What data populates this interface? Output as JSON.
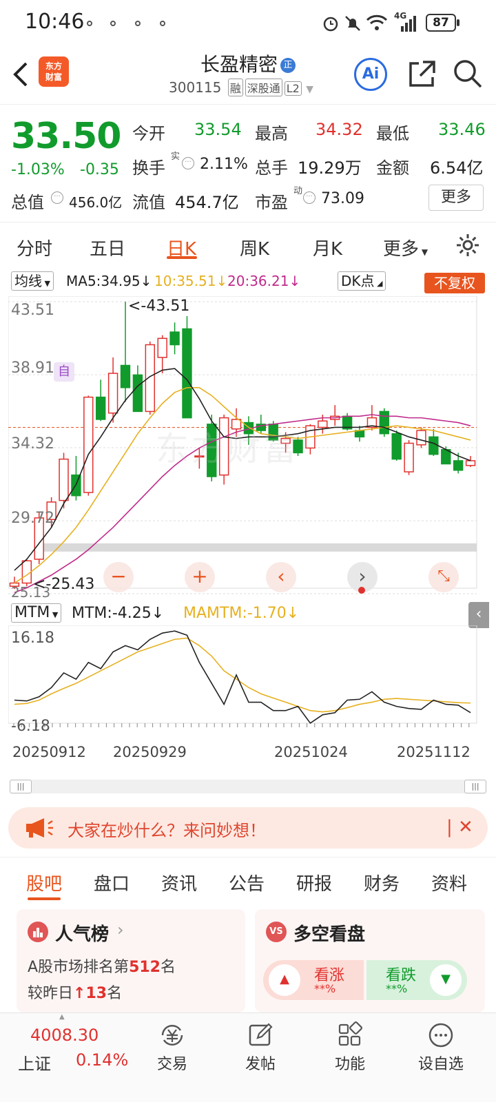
{
  "status_bar": {
    "time": "10:46",
    "battery": "87",
    "network": "4G"
  },
  "header": {
    "logo_line1": "东方",
    "logo_line2": "财富",
    "stock_name": "长盈精密",
    "stock_code": "300115",
    "tags": [
      "融",
      "深股通",
      "L2"
    ]
  },
  "quote": {
    "price": "33.50",
    "change_pct": "-1.03%",
    "change_amt": "-0.35",
    "open_label": "今开",
    "open": "33.54",
    "high_label": "最高",
    "high": "34.32",
    "low_label": "最低",
    "low": "33.46",
    "turnover_label": "换手",
    "turnover_sup": "实",
    "turnover": "2.11%",
    "volume_label": "总手",
    "volume": "19.29万",
    "amount_label": "金额",
    "amount": "6.54亿",
    "mktcap_label": "总值",
    "mktcap": "456.0亿",
    "float_label": "流值",
    "float": "454.7亿",
    "pe_label": "市盈",
    "pe_sup": "动",
    "pe": "73.09",
    "more_label": "更多"
  },
  "chart_tabs": [
    "分时",
    "五日",
    "日K",
    "周K",
    "月K",
    "更多"
  ],
  "ma_bar": {
    "selector": "均线",
    "ma5": "MA5:34.95↓",
    "ma10": "10:35.51↓",
    "ma20": "20:36.21↓",
    "dk": "DK点",
    "fuquan": "不复权"
  },
  "kline_labels": {
    "y_ticks": [
      "43.51",
      "38.91",
      "34.32",
      "29.72",
      "25.13"
    ],
    "max_note": "<-43.51",
    "min_note": "<-25.43",
    "watermark": "东方财富",
    "zi": "自"
  },
  "mtm_bar": {
    "selector": "MTM",
    "mtm": "MTM:-4.25↓",
    "mamtm": "MAMTM:-1.70↓",
    "y_max": "16.18",
    "y_min": "-6.18"
  },
  "dates": [
    "20250912",
    "20250929",
    "20251024",
    "20251112"
  ],
  "banner": {
    "text": "大家在炒什么？来问妙想！"
  },
  "bottom_tabs": [
    "股吧",
    "盘口",
    "资讯",
    "公告",
    "研报",
    "财务",
    "资料"
  ],
  "popularity": {
    "title": "人气榜",
    "line1_prefix": "A股市场排名第",
    "rank": "512",
    "line1_suffix": "名",
    "line2_prefix": "较昨日",
    "change": "13",
    "line2_suffix": "名"
  },
  "bullbear": {
    "title": "多空看盘",
    "up_label": "看涨",
    "up_val": "**%",
    "down_label": "看跌",
    "down_val": "**%"
  },
  "nav": {
    "index_value": "4008.30",
    "index_name": "上证",
    "index_pct": "0.14%",
    "items": [
      "交易",
      "发帖",
      "功能",
      "设自选"
    ]
  },
  "chart_data": {
    "type": "candlestick",
    "ylim": [
      25.13,
      43.51
    ],
    "y_ticks": [
      43.51,
      38.91,
      34.32,
      29.72,
      25.13
    ],
    "candles": [
      {
        "o": 25.6,
        "h": 26.2,
        "l": 25.43,
        "c": 25.8
      },
      {
        "o": 25.8,
        "h": 27.3,
        "l": 25.6,
        "c": 27.2
      },
      {
        "o": 27.3,
        "h": 30.3,
        "l": 27.0,
        "c": 29.9
      },
      {
        "o": 29.8,
        "h": 31.2,
        "l": 29.3,
        "c": 30.9
      },
      {
        "o": 31.0,
        "h": 34.0,
        "l": 30.5,
        "c": 33.6
      },
      {
        "o": 32.6,
        "h": 33.8,
        "l": 31.0,
        "c": 31.3
      },
      {
        "o": 31.5,
        "h": 37.6,
        "l": 31.3,
        "c": 37.5
      },
      {
        "o": 37.5,
        "h": 38.6,
        "l": 36.0,
        "c": 36.1
      },
      {
        "o": 36.5,
        "h": 40.0,
        "l": 35.9,
        "c": 39.0
      },
      {
        "o": 39.5,
        "h": 43.51,
        "l": 37.2,
        "c": 38.1
      },
      {
        "o": 38.9,
        "h": 39.5,
        "l": 36.6,
        "c": 36.6
      },
      {
        "o": 36.6,
        "h": 41.0,
        "l": 36.4,
        "c": 40.8
      },
      {
        "o": 40.0,
        "h": 41.4,
        "l": 39.0,
        "c": 41.2
      },
      {
        "o": 41.6,
        "h": 42.2,
        "l": 40.2,
        "c": 40.8
      },
      {
        "o": 41.8,
        "h": 42.6,
        "l": 36.2,
        "c": 36.2
      },
      {
        "o": 33.8,
        "h": 34.3,
        "l": 33.0,
        "c": 33.8
      },
      {
        "o": 35.8,
        "h": 36.4,
        "l": 32.2,
        "c": 32.5
      },
      {
        "o": 32.6,
        "h": 36.4,
        "l": 32.0,
        "c": 36.2
      },
      {
        "o": 35.5,
        "h": 36.8,
        "l": 35.0,
        "c": 36.1
      },
      {
        "o": 35.9,
        "h": 36.3,
        "l": 34.5,
        "c": 35.2
      },
      {
        "o": 35.8,
        "h": 36.4,
        "l": 35.2,
        "c": 35.4
      },
      {
        "o": 35.8,
        "h": 36.0,
        "l": 34.7,
        "c": 34.8
      },
      {
        "o": 34.6,
        "h": 35.3,
        "l": 34.0,
        "c": 34.9
      },
      {
        "o": 34.8,
        "h": 35.0,
        "l": 33.8,
        "c": 34.0
      },
      {
        "o": 34.3,
        "h": 35.8,
        "l": 33.9,
        "c": 35.7
      },
      {
        "o": 35.6,
        "h": 36.4,
        "l": 35.2,
        "c": 36.0
      },
      {
        "o": 36.1,
        "h": 37.0,
        "l": 35.7,
        "c": 36.3
      },
      {
        "o": 36.3,
        "h": 36.5,
        "l": 35.4,
        "c": 35.5
      },
      {
        "o": 35.4,
        "h": 35.7,
        "l": 34.7,
        "c": 35.0
      },
      {
        "o": 35.6,
        "h": 37.0,
        "l": 35.4,
        "c": 36.2
      },
      {
        "o": 36.6,
        "h": 36.8,
        "l": 35.0,
        "c": 35.2
      },
      {
        "o": 35.2,
        "h": 35.4,
        "l": 33.5,
        "c": 33.6
      },
      {
        "o": 32.8,
        "h": 34.8,
        "l": 32.6,
        "c": 34.6
      },
      {
        "o": 34.5,
        "h": 35.6,
        "l": 34.3,
        "c": 35.4
      },
      {
        "o": 35.0,
        "h": 35.5,
        "l": 33.8,
        "c": 33.9
      },
      {
        "o": 34.2,
        "h": 34.4,
        "l": 33.3,
        "c": 33.3
      },
      {
        "o": 33.5,
        "h": 34.0,
        "l": 32.7,
        "c": 32.9
      },
      {
        "o": 33.2,
        "h": 33.8,
        "l": 33.1,
        "c": 33.5
      }
    ],
    "ma5": [
      26.6,
      27.3,
      28.3,
      29.3,
      30.8,
      32.0,
      33.9,
      35.0,
      36.2,
      37.3,
      38.2,
      38.8,
      39.2,
      39.3,
      38.6,
      37.4,
      36.0,
      35.0,
      34.9,
      35.0,
      35.0,
      35.0,
      35.1,
      35.2,
      35.4,
      35.5,
      35.6,
      35.6,
      35.6,
      35.7,
      35.6,
      35.3,
      35.0,
      34.8,
      34.6,
      34.2,
      33.8,
      33.5
    ],
    "ma10": [
      25.8,
      26.3,
      26.9,
      27.6,
      28.4,
      29.3,
      30.4,
      31.6,
      32.8,
      34.0,
      35.2,
      36.2,
      37.1,
      37.8,
      38.1,
      38.1,
      37.6,
      36.9,
      36.2,
      35.6,
      35.2,
      35.1,
      35.0,
      34.9,
      35.0,
      35.1,
      35.2,
      35.3,
      35.4,
      35.5,
      35.6,
      35.7,
      35.6,
      35.5,
      35.4,
      35.2,
      35.0,
      34.8
    ],
    "ma20": [
      25.2,
      25.5,
      25.9,
      26.3,
      26.8,
      27.3,
      27.9,
      28.6,
      29.3,
      30.1,
      30.9,
      31.7,
      32.5,
      33.2,
      33.8,
      34.3,
      34.7,
      35.0,
      35.3,
      35.5,
      35.7,
      35.8,
      35.9,
      36.0,
      36.1,
      36.2,
      36.2,
      36.3,
      36.3,
      36.4,
      36.3,
      36.3,
      36.2,
      36.2,
      36.1,
      36.0,
      35.9,
      35.7
    ],
    "mtm": [
      -1.0,
      -1.2,
      -0.2,
      2.0,
      5.5,
      4.0,
      8.0,
      6.5,
      10.5,
      12.0,
      11.0,
      13.5,
      15.0,
      15.5,
      14.5,
      8.0,
      3.0,
      -2.0,
      5.0,
      -1.5,
      -1.5,
      -3.5,
      -3.5,
      -2.5,
      -6.5,
      -4.5,
      -4.0,
      -1.0,
      -0.8,
      1.0,
      -1.5,
      -2.5,
      -3.0,
      -3.2,
      -1.0,
      -2.0,
      -2.2,
      -4.0
    ],
    "mamtm": [
      -2.0,
      -1.8,
      -1.0,
      0.5,
      1.8,
      3.0,
      4.5,
      6.0,
      7.5,
      9.0,
      10.5,
      11.5,
      12.5,
      13.5,
      13.8,
      12.0,
      9.5,
      6.0,
      4.0,
      2.0,
      0.5,
      -0.5,
      -1.5,
      -2.5,
      -3.5,
      -3.8,
      -3.5,
      -2.8,
      -2.0,
      -1.5,
      -0.8,
      -0.6,
      -0.8,
      -1.0,
      -1.2,
      -1.4,
      -1.6,
      -1.7
    ],
    "mtm_ylim": [
      -6.18,
      16.18
    ]
  }
}
